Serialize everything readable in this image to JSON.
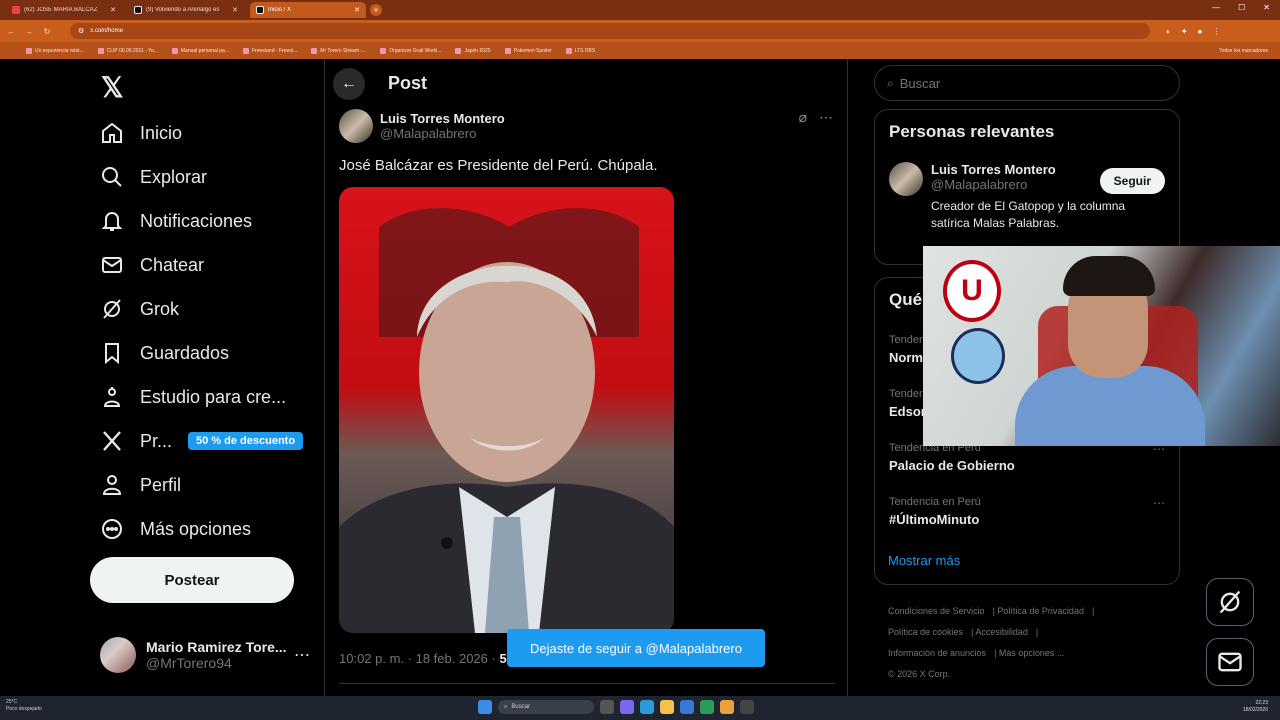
{
  "browser": {
    "tabs": [
      {
        "title": "(62) JOSÉ MARÍA BALCÁZ",
        "active": false
      },
      {
        "title": "(9) Volviendo a Arenalgo es",
        "active": false
      },
      {
        "title": "Inicio / X",
        "active": true
      }
    ],
    "url": "x.com/home",
    "bookmarks": [
      "Un experiencia relat...",
      "CLIP 06.09.2011 - Yo...",
      "Manual personal pa...",
      "Freestand - Freest...",
      "Mr Torero Stream -...",
      "Organizar Grail Worki...",
      "Japón 2025",
      "Pokemon Spoiler",
      "LTS DBS"
    ],
    "all_bookmarks": "Todos los marcadores"
  },
  "nav": {
    "items": [
      {
        "label": "Inicio",
        "icon": "home-icon"
      },
      {
        "label": "Explorar",
        "icon": "search-icon"
      },
      {
        "label": "Notificaciones",
        "icon": "bell-icon"
      },
      {
        "label": "Chatear",
        "icon": "mail-icon"
      },
      {
        "label": "Grok",
        "icon": "grok-icon"
      },
      {
        "label": "Guardados",
        "icon": "bookmark-icon"
      },
      {
        "label": "Estudio para cre...",
        "icon": "studio-icon"
      },
      {
        "label": "Pr...",
        "icon": "x-icon"
      },
      {
        "label": "Perfil",
        "icon": "person-icon"
      },
      {
        "label": "Más opciones",
        "icon": "more-circle-icon"
      }
    ],
    "premium_badge": "50 % de descuento",
    "post_button": "Postear",
    "account": {
      "name": "Mario Ramirez Tore...",
      "handle": "@MrTorero94"
    }
  },
  "main": {
    "title": "Post",
    "author": {
      "name": "Luis Torres Montero",
      "handle": "@Malapalabrero"
    },
    "text": "José Balcázar es Presidente del Perú. Chúpala.",
    "time": "10:02 p. m. · 18 feb. 2026 · ",
    "views_fragment": "5",
    "toast": "Dejaste de seguir a @Malapalabrero"
  },
  "right": {
    "search_placeholder": "Buscar",
    "relevant": {
      "title": "Personas relevantes",
      "name": "Luis Torres Montero",
      "handle": "@Malapalabrero",
      "follow": "Seguir",
      "bio": "Creador de El Gatopop y la columna satírica Malas Palabras. Periodista/poeta/guionista."
    },
    "trends_title": "Qué",
    "trends": [
      {
        "category": "Tendencia",
        "name": "Norm"
      },
      {
        "category": "Tendenc",
        "name": "Edsor"
      },
      {
        "category": "Tendencia en Perú",
        "name": "Palacio de Gobierno"
      },
      {
        "category": "Tendencia en Perú",
        "name": "#ÚltimoMinuto"
      }
    ],
    "show_more": "Mostrar más",
    "footer": [
      "Condiciones de Servicio",
      "Política de Privacidad",
      "Política de cookies",
      "Accesibilidad",
      "Información de anuncios",
      "Más opciones ...",
      "© 2026 X Corp."
    ]
  },
  "taskbar": {
    "weather_temp": "25°C",
    "weather_desc": "Poco despejado",
    "search": "Buscar",
    "time": "22:23",
    "date": "18/02/2026"
  }
}
